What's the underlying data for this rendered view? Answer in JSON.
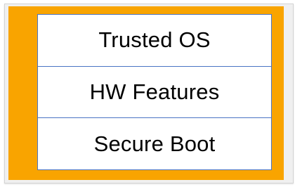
{
  "diagram": {
    "layers": [
      {
        "label": "Trusted OS"
      },
      {
        "label": "HW Features"
      },
      {
        "label": "Secure Boot"
      }
    ],
    "colors": {
      "background": "#f9a400",
      "box_border": "#4a74c4",
      "box_fill": "#ffffff",
      "text": "#000000"
    }
  }
}
